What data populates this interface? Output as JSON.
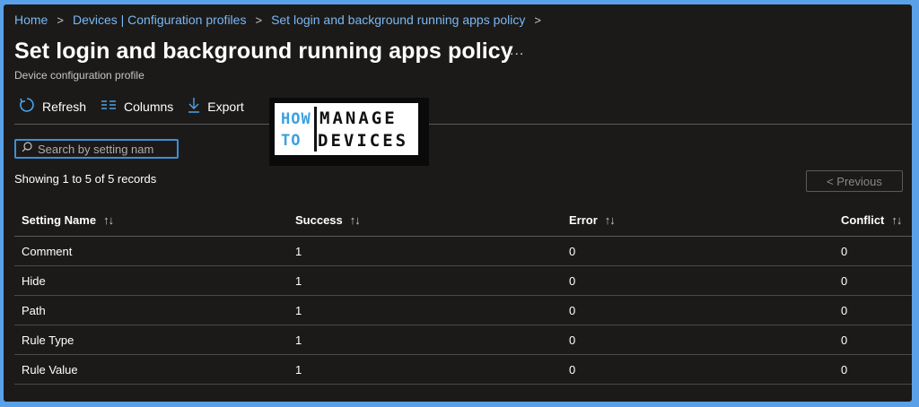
{
  "breadcrumb": [
    {
      "label": "Home"
    },
    {
      "label": "Devices | Configuration profiles"
    },
    {
      "label": "Set login and background running apps policy"
    }
  ],
  "page": {
    "title": "Set login and background running apps policy",
    "more_label": "...",
    "subtitle": "Device configuration profile"
  },
  "toolbar": {
    "refresh_label": "Refresh",
    "columns_label": "Columns",
    "export_label": "Export"
  },
  "logo": {
    "how": "HOW",
    "to": "TO",
    "manage": "MANAGE",
    "devices": "DEVICES"
  },
  "search": {
    "placeholder": "Search by setting nam"
  },
  "records_text": "Showing 1 to 5 of 5 records",
  "pagination": {
    "previous_label": "< Previous"
  },
  "table": {
    "columns": [
      "Setting Name",
      "Success",
      "Error",
      "Conflict"
    ],
    "sort_icon": "↑↓",
    "rows": [
      [
        "Comment",
        "1",
        "0",
        "0"
      ],
      [
        "Hide",
        "1",
        "0",
        "0"
      ],
      [
        "Path",
        "1",
        "0",
        "0"
      ],
      [
        "Rule Type",
        "1",
        "0",
        "0"
      ],
      [
        "Rule Value",
        "1",
        "0",
        "0"
      ]
    ]
  },
  "colors": {
    "background": "#1b1a19",
    "link": "#79b8f3",
    "accent": "#3c8fd6",
    "outer_border": "#5aa0e8"
  }
}
